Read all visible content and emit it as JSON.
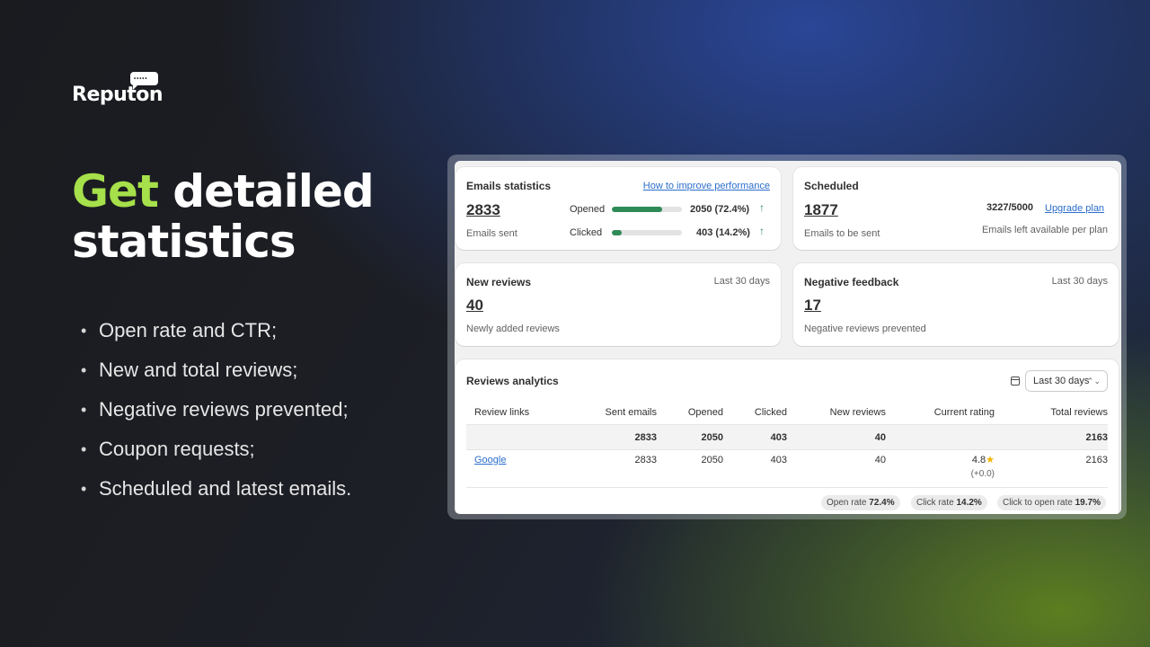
{
  "brand": {
    "name": "Reputon",
    "bubble_dots": "•••••"
  },
  "headline": {
    "accent": "Get",
    "rest_line1": "detailed",
    "line2": "statistics"
  },
  "bullets": [
    "Open rate and CTR;",
    "New and total reviews;",
    "Negative reviews prevented;",
    "Coupon requests;",
    "Scheduled and latest emails."
  ],
  "colors": {
    "accent": "#a6e04a",
    "progress": "#2e8b57",
    "link": "#2c6ecb"
  },
  "emails_statistics": {
    "title": "Emails statistics",
    "help_link": "How to improve performance",
    "emails_sent": "2833",
    "emails_sent_label": "Emails sent",
    "metrics": [
      {
        "label": "Opened",
        "value": "2050 (72.4%)",
        "fraction": 0.724,
        "trend_icon": "arrow-up-icon"
      },
      {
        "label": "Clicked",
        "value": "403 (14.2%)",
        "fraction": 0.142,
        "trend_icon": "arrow-up-icon"
      }
    ]
  },
  "scheduled": {
    "title": "Scheduled",
    "count": "1877",
    "count_label": "Emails to be sent",
    "quota": "3227/5000",
    "upgrade_link": "Upgrade plan",
    "quota_label": "Emails left available per plan"
  },
  "new_reviews": {
    "title": "New reviews",
    "period": "Last 30 days",
    "count": "40",
    "label": "Newly added reviews"
  },
  "negative_feedback": {
    "title": "Negative feedback",
    "period": "Last 30 days",
    "count": "17",
    "label": "Negative reviews prevented"
  },
  "reviews_analytics": {
    "title": "Reviews analytics",
    "date_range": "Last 30 days",
    "columns": [
      "Review links",
      "Sent emails",
      "Opened",
      "Clicked",
      "New reviews",
      "Current rating",
      "Total reviews"
    ],
    "totals": [
      "",
      "2833",
      "2050",
      "403",
      "40",
      "",
      "2163"
    ],
    "rows": [
      {
        "link": "Google",
        "sent": "2833",
        "opened": "2050",
        "clicked": "403",
        "new_reviews": "40",
        "rating": "4.8",
        "rating_icon": "star-icon",
        "rating_delta": "(+0.0)",
        "total": "2163"
      }
    ],
    "rates": [
      {
        "label": "Open rate",
        "value": "72.4%"
      },
      {
        "label": "Click rate",
        "value": "14.2%"
      },
      {
        "label": "Click to open rate",
        "value": "19.7%"
      }
    ]
  }
}
